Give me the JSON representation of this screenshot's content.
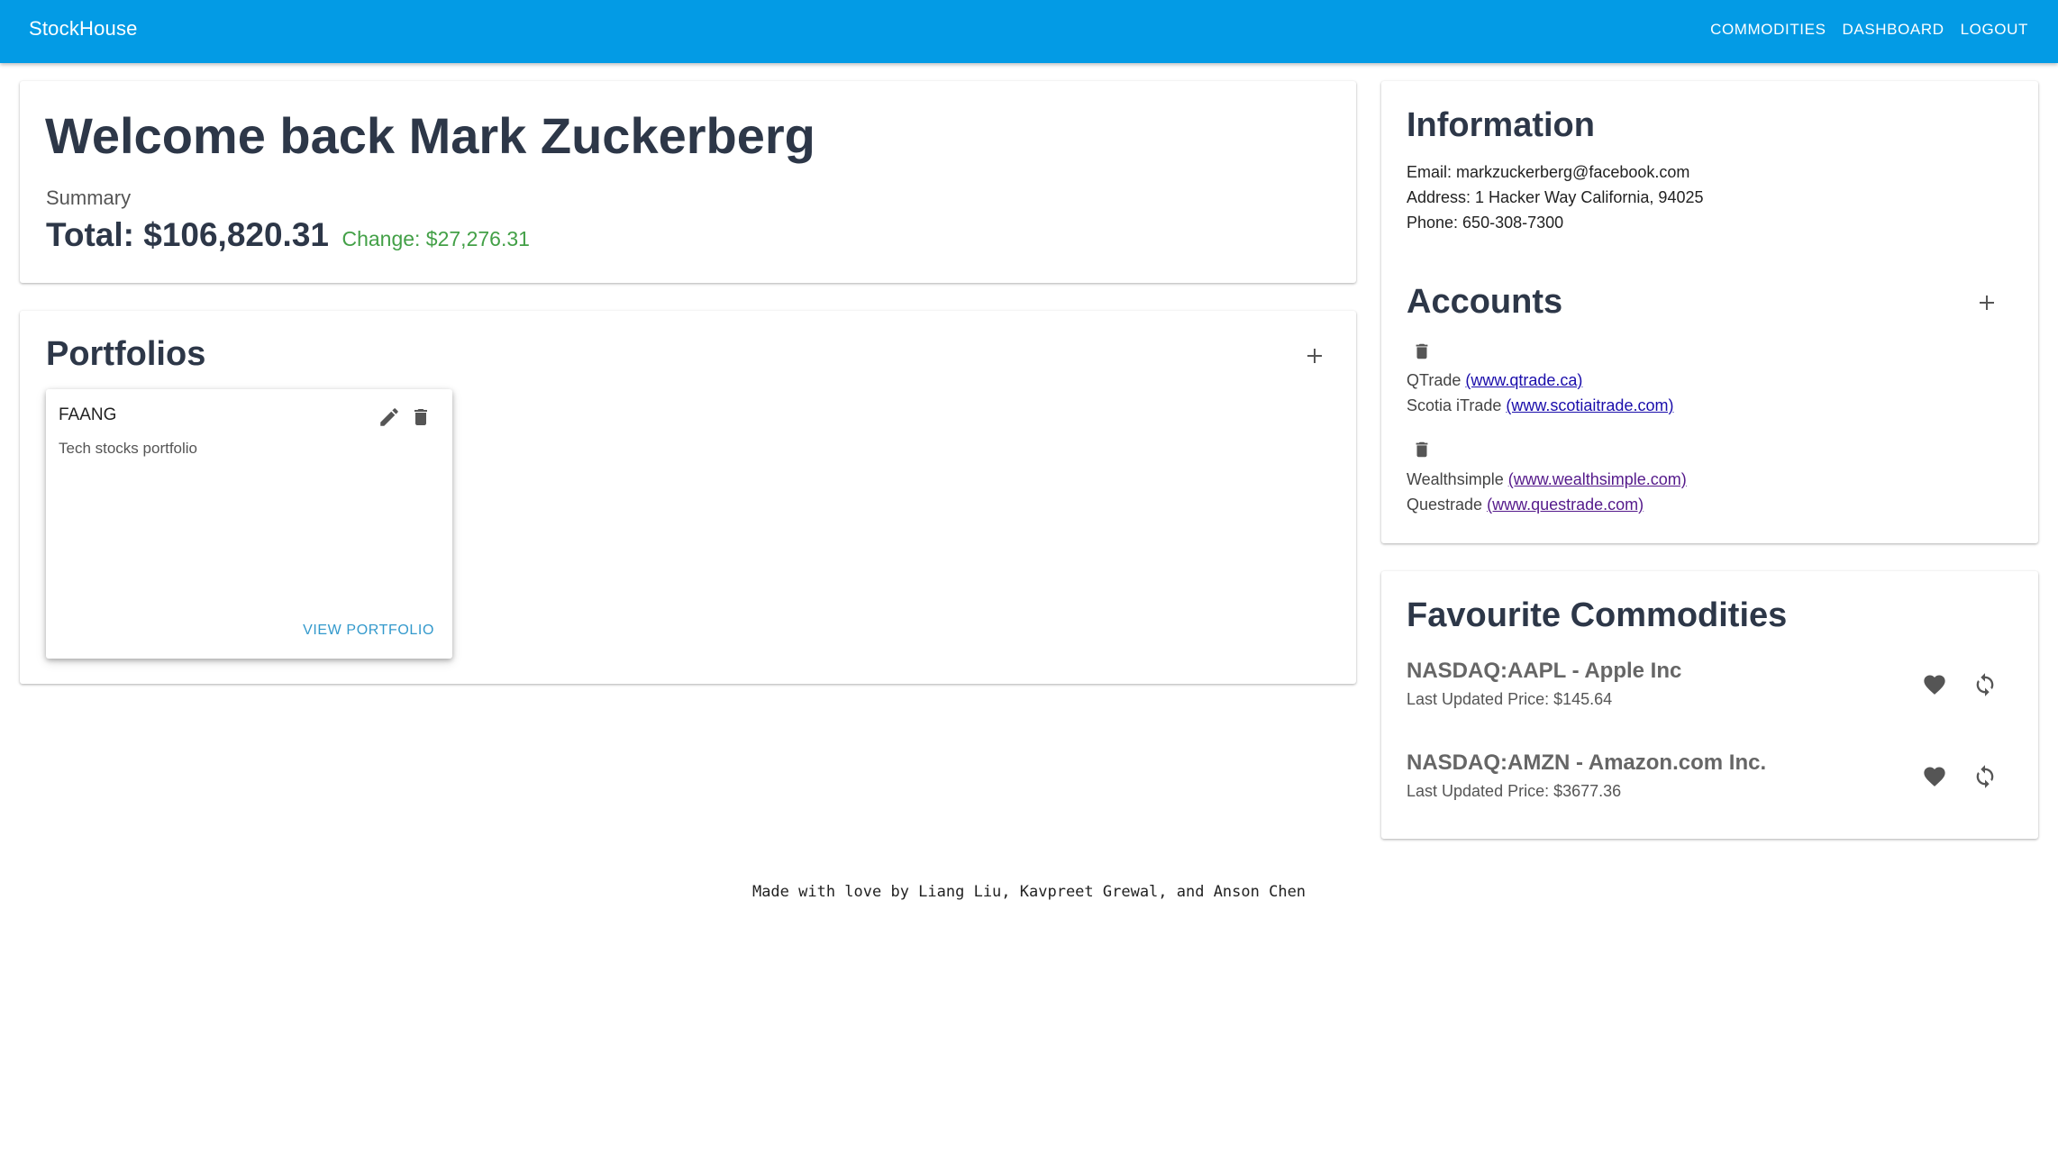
{
  "appbar": {
    "brand": "StockHouse",
    "nav": [
      "COMMODITIES",
      "DASHBOARD",
      "LOGOUT"
    ],
    "color": "#039be5"
  },
  "welcome": {
    "title": "Welcome back Mark Zuckerberg",
    "summary_label": "Summary",
    "total": "Total: $106,820.31",
    "change": "Change: $27,276.31",
    "change_color": "#43a047"
  },
  "portfolios": {
    "title": "Portfolios",
    "add_icon": "plus-icon",
    "items": [
      {
        "name": "FAANG",
        "description": "Tech stocks portfolio",
        "view_label": "VIEW PORTFOLIO",
        "icons": [
          "pencil-icon",
          "trash-icon"
        ]
      }
    ]
  },
  "information": {
    "title": "Information",
    "email": "Email: markzuckerberg@facebook.com",
    "address": "Address: 1 Hacker Way California, 94025",
    "phone": "Phone: 650-308-7300"
  },
  "accounts": {
    "title": "Accounts",
    "add_icon": "plus-icon",
    "groups": [
      [
        {
          "name": "QTrade",
          "link": "(www.qtrade.ca)"
        },
        {
          "name": "Scotia iTrade",
          "link": "(www.scotiaitrade.com)"
        }
      ],
      [
        {
          "name": "Wealthsimple",
          "link": "(www.wealthsimple.com)"
        },
        {
          "name": "Questrade",
          "link": "(www.questrade.com)"
        }
      ]
    ]
  },
  "favourites": {
    "title": "Favourite Commodities",
    "items": [
      {
        "symbol": "NASDAQ:AAPL - Apple Inc",
        "price": "Last Updated Price: $145.64"
      },
      {
        "symbol": "NASDAQ:AMZN - Amazon.com Inc.",
        "price": "Last Updated Price: $3677.36"
      }
    ]
  },
  "footer": {
    "text": "Made with love by Liang Liu, Kavpreet Grewal, and Anson Chen"
  }
}
